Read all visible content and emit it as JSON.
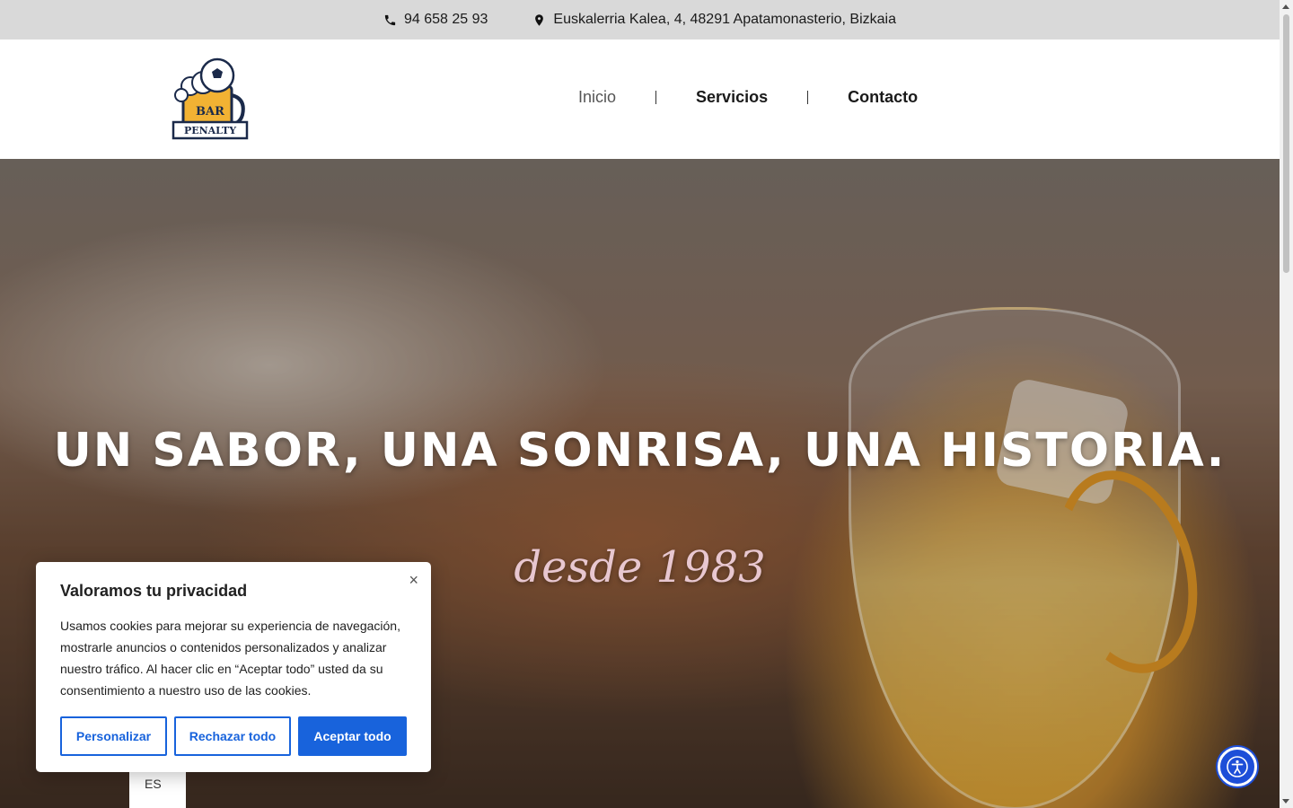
{
  "topbar": {
    "phone": "94 658 25 93",
    "phone_icon": "phone-icon",
    "address": "Euskalerria Kalea, 4, 48291 Apatamonasterio, Bizkaia",
    "address_icon": "map-pin-icon"
  },
  "header": {
    "logo": {
      "line1": "BAR",
      "line2": "PENALTY"
    },
    "nav": [
      {
        "label": "Inicio",
        "active": true
      },
      {
        "label": "Servicios",
        "active": false
      },
      {
        "label": "Contacto",
        "active": false
      }
    ]
  },
  "hero": {
    "title": "UN SABOR, UNA SONRISA, UNA HISTORIA.",
    "subtitle": "desde 1983"
  },
  "language": {
    "current": "ES"
  },
  "cookie_banner": {
    "title": "Valoramos tu privacidad",
    "body": "Usamos cookies para mejorar su experiencia de navegación, mostrarle anuncios o contenidos personalizados y analizar nuestro tráfico. Al hacer clic en “Aceptar todo” usted da su consentimiento a nuestro uso de las cookies.",
    "close": "×",
    "buttons": {
      "customize": "Personalizar",
      "reject": "Rechazar todo",
      "accept": "Aceptar todo"
    },
    "accent_color": "#1863dc"
  },
  "accessibility": {
    "icon": "accessibility-icon",
    "color": "#1d4ed8"
  }
}
